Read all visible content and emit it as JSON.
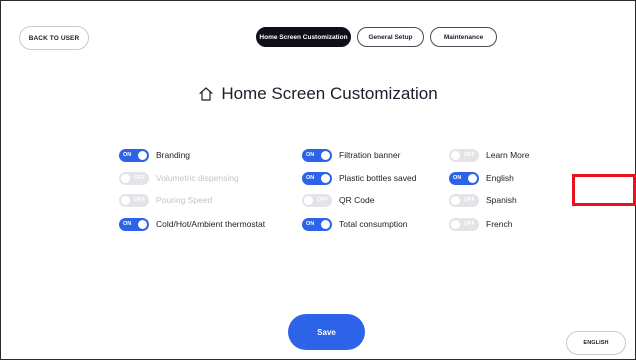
{
  "header": {
    "back_label": "BACK TO USER",
    "tabs": [
      {
        "label": "Home Screen Customization",
        "active": true
      },
      {
        "label": "General Setup",
        "active": false
      },
      {
        "label": "Maintenance",
        "active": false
      }
    ]
  },
  "page": {
    "title": "Home Screen Customization",
    "title_icon": "home-icon"
  },
  "toggle_text": {
    "on": "ON",
    "off": "OFF"
  },
  "options": {
    "col1": [
      {
        "label": "Branding",
        "state": "on",
        "enabled": true
      },
      {
        "label": "Volumetric dispensing",
        "state": "off",
        "enabled": false
      },
      {
        "label": "Pouring Speed",
        "state": "off",
        "enabled": false
      },
      {
        "label": "Cold/Hot/Ambient thermostat",
        "state": "on",
        "enabled": true
      }
    ],
    "col2": [
      {
        "label": "Filtration banner",
        "state": "on",
        "enabled": true
      },
      {
        "label": "Plastic bottles saved",
        "state": "on",
        "enabled": true
      },
      {
        "label": "QR Code",
        "state": "off",
        "enabled": true
      },
      {
        "label": "Total consumption",
        "state": "on",
        "enabled": true
      }
    ],
    "col3": [
      {
        "label": "Learn More",
        "state": "off",
        "enabled": true
      },
      {
        "label": "English",
        "state": "on",
        "enabled": true
      },
      {
        "label": "Spanish",
        "state": "off",
        "enabled": true
      },
      {
        "label": "French",
        "state": "off",
        "enabled": true
      }
    ]
  },
  "footer": {
    "save_label": "Save",
    "language_label": "ENGLISH"
  },
  "colors": {
    "accent": "#2c63e8",
    "toggle_off": "#e4e4e8",
    "active_tab": "#0f0f1a",
    "highlight": "#e8121c"
  }
}
